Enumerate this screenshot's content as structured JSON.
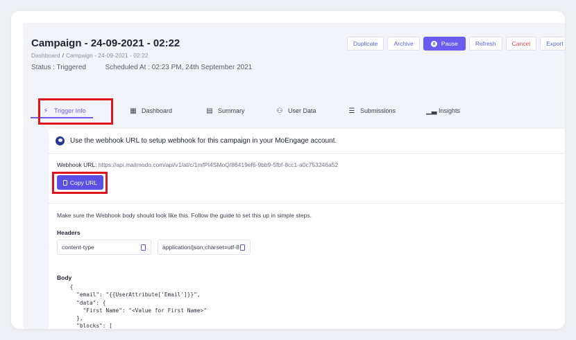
{
  "header": {
    "title": "Campaign - 24-09-2021 - 02:22",
    "breadcrumb": [
      "Dashboard",
      "Campaign - 24-09-2021 - 02:22"
    ],
    "status_label": "Status :",
    "status_value": "Triggered",
    "scheduled_label": "Scheduled At :",
    "scheduled_value": "02:23 PM, 24th September 2021"
  },
  "actions": {
    "duplicate": "Duplicate",
    "archive": "Archive",
    "pause": "Pause",
    "refresh": "Refresh",
    "cancel": "Cancel",
    "export": "Export Data"
  },
  "tabs": [
    {
      "label": "Trigger Info",
      "icon": "bolt-icon"
    },
    {
      "label": "Dashboard",
      "icon": "dashboard-icon"
    },
    {
      "label": "Summary",
      "icon": "summary-icon"
    },
    {
      "label": "User Data",
      "icon": "users-icon"
    },
    {
      "label": "Submissions",
      "icon": "list-icon"
    },
    {
      "label": "Insights",
      "icon": "chart-icon"
    }
  ],
  "content": {
    "info_text": "Use the webhook URL to setup webhook for this campaign in your MoEngage account.",
    "webhook_label": "Webhook URL:",
    "webhook_url": "https://api.mailmodo.com/api/v1/at/c/1mfPI4SMoQ/86419ef6-9bb9-5fbf-8cc1-a0c753246a52",
    "copy_button": "Copy URL",
    "hint": "Make sure the Webhook body should look like this. Follow the guide to set this up in simple steps.",
    "headers_label": "Headers",
    "header_key": "content-type",
    "header_value": "application/json;charset=utf-8",
    "body_label": "Body",
    "body_code": "    {\n      \"email\": \"{{UserAttribute['Email']}}\",\n      \"data\": {\n        \"First Name\": \"<Value for First Name>\"\n      },\n      \"blocks\": [\n        {"
  },
  "colors": {
    "accent": "#6a5cf0",
    "highlight": "#e0151b",
    "cancel": "#e04a4a"
  }
}
